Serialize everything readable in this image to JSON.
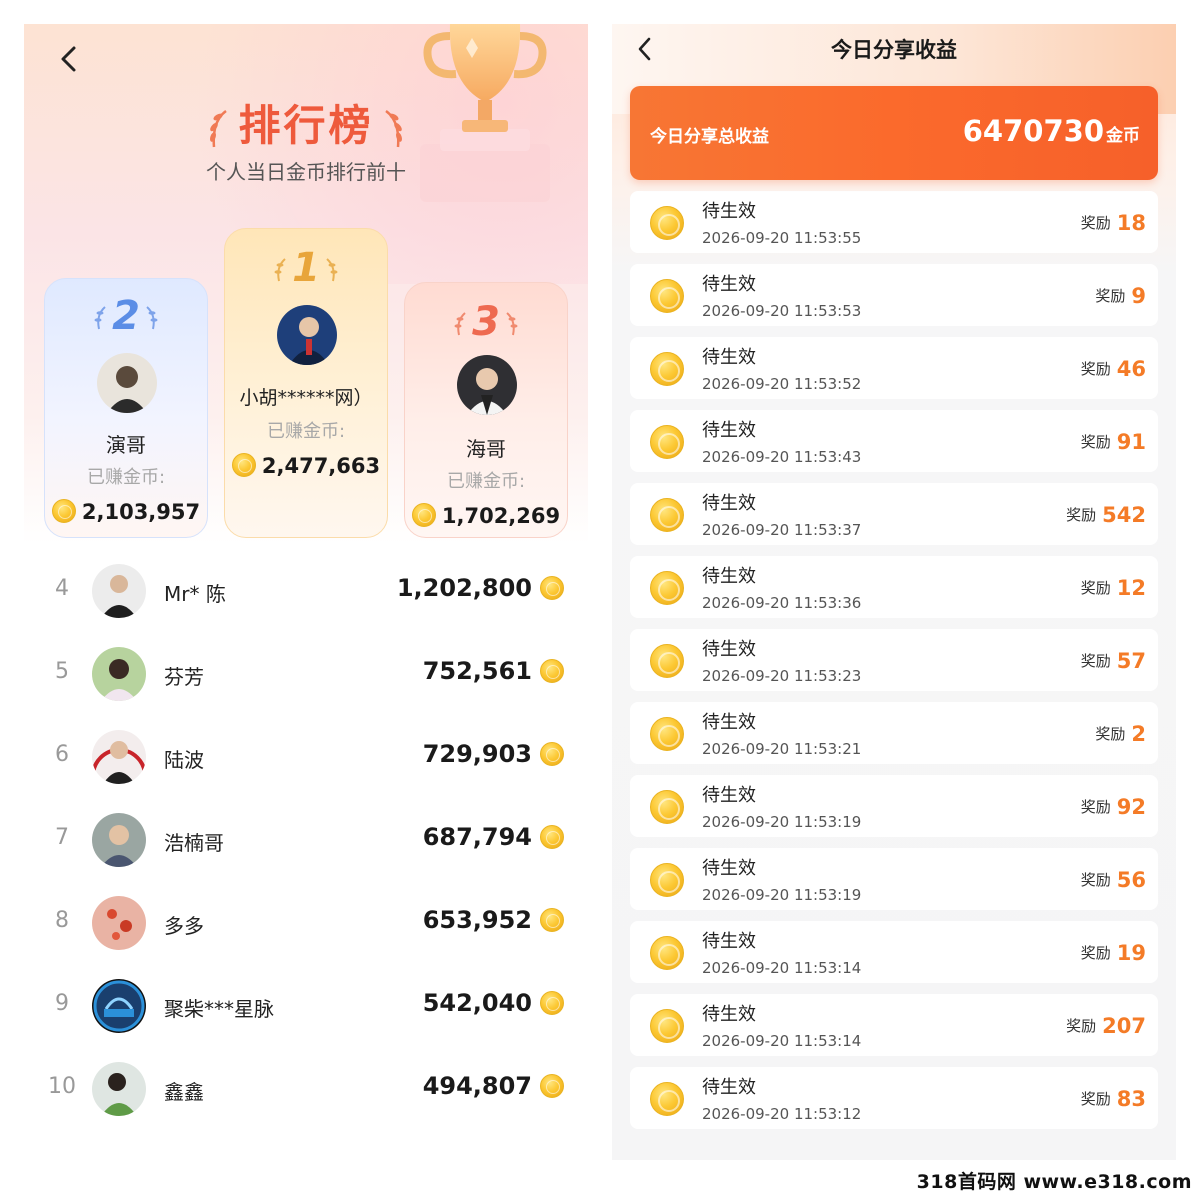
{
  "leaderboard": {
    "title": "排行榜",
    "subtitle": "个人当日金币排行前十",
    "podium": [
      {
        "rank": "2",
        "name": "演哥",
        "earned_label": "已赚金币:",
        "amount": "2,103,957"
      },
      {
        "rank": "1",
        "name": "小胡******网）",
        "earned_label": "已赚金币:",
        "amount": "2,477,663"
      },
      {
        "rank": "3",
        "name": "海哥",
        "earned_label": "已赚金币:",
        "amount": "1,702,269"
      }
    ],
    "rows": [
      {
        "rank": "4",
        "name": "Mr* 陈",
        "amount": "1,202,800"
      },
      {
        "rank": "5",
        "name": "芬芳",
        "amount": "752,561"
      },
      {
        "rank": "6",
        "name": "陆波",
        "amount": "729,903"
      },
      {
        "rank": "7",
        "name": "浩楠哥",
        "amount": "687,794"
      },
      {
        "rank": "8",
        "name": "多多",
        "amount": "653,952"
      },
      {
        "rank": "9",
        "name": "聚柴***星脉",
        "amount": "542,040"
      },
      {
        "rank": "10",
        "name": "鑫鑫",
        "amount": "494,807"
      }
    ]
  },
  "earnings": {
    "title": "今日分享收益",
    "total_label": "今日分享总收益",
    "total_value": "6470730",
    "total_unit": "金币",
    "reward_label": "奖励",
    "records": [
      {
        "status": "待生效",
        "time": "2026-09-20 11:53:55",
        "reward": "18"
      },
      {
        "status": "待生效",
        "time": "2026-09-20 11:53:53",
        "reward": "9"
      },
      {
        "status": "待生效",
        "time": "2026-09-20 11:53:52",
        "reward": "46"
      },
      {
        "status": "待生效",
        "time": "2026-09-20 11:53:43",
        "reward": "91"
      },
      {
        "status": "待生效",
        "time": "2026-09-20 11:53:37",
        "reward": "542"
      },
      {
        "status": "待生效",
        "time": "2026-09-20 11:53:36",
        "reward": "12"
      },
      {
        "status": "待生效",
        "time": "2026-09-20 11:53:23",
        "reward": "57"
      },
      {
        "status": "待生效",
        "time": "2026-09-20 11:53:21",
        "reward": "2"
      },
      {
        "status": "待生效",
        "time": "2026-09-20 11:53:19",
        "reward": "92"
      },
      {
        "status": "待生效",
        "time": "2026-09-20 11:53:19",
        "reward": "56"
      },
      {
        "status": "待生效",
        "time": "2026-09-20 11:53:14",
        "reward": "19"
      },
      {
        "status": "待生效",
        "time": "2026-09-20 11:53:14",
        "reward": "207"
      },
      {
        "status": "待生效",
        "time": "2026-09-20 11:53:12",
        "reward": "83"
      }
    ]
  },
  "icons": {
    "back": "chevron-left-icon",
    "coin": "gold-coin-icon",
    "trophy": "trophy-icon",
    "laurel": "laurel-icon"
  },
  "colors": {
    "accent_orange": "#f66a2c",
    "reward_orange": "#f47b27",
    "title_red": "#ee5a3c",
    "rank2_blue": "#5b8de6",
    "rank1_gold": "#e8a53a",
    "rank3_coral": "#ee6a50"
  },
  "watermark": "318首码网 www.e318.com"
}
